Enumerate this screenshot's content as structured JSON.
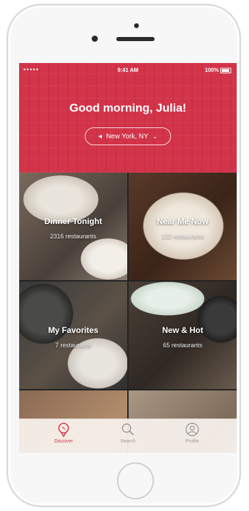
{
  "status_bar": {
    "signal": "●●●●● ",
    "time": "9:41 AM",
    "battery": "100%"
  },
  "header": {
    "greeting": "Good morning, Julia!",
    "location": "New York, NY"
  },
  "categories": [
    {
      "title": "Dinner Tonight",
      "count": "2316 restaurants"
    },
    {
      "title": "Near Me Now",
      "count": "152 restaurants"
    },
    {
      "title": "My Favorites",
      "count": "7 restaurants"
    },
    {
      "title": "New & Hot",
      "count": "65 restaurants"
    }
  ],
  "tabs": [
    {
      "label": "Discover",
      "icon": "discover-icon"
    },
    {
      "label": "Search",
      "icon": "search-icon"
    },
    {
      "label": "Profile",
      "icon": "profile-icon"
    }
  ],
  "colors": {
    "brand": "#d3344a",
    "tab_inactive": "#9a9a9a"
  }
}
